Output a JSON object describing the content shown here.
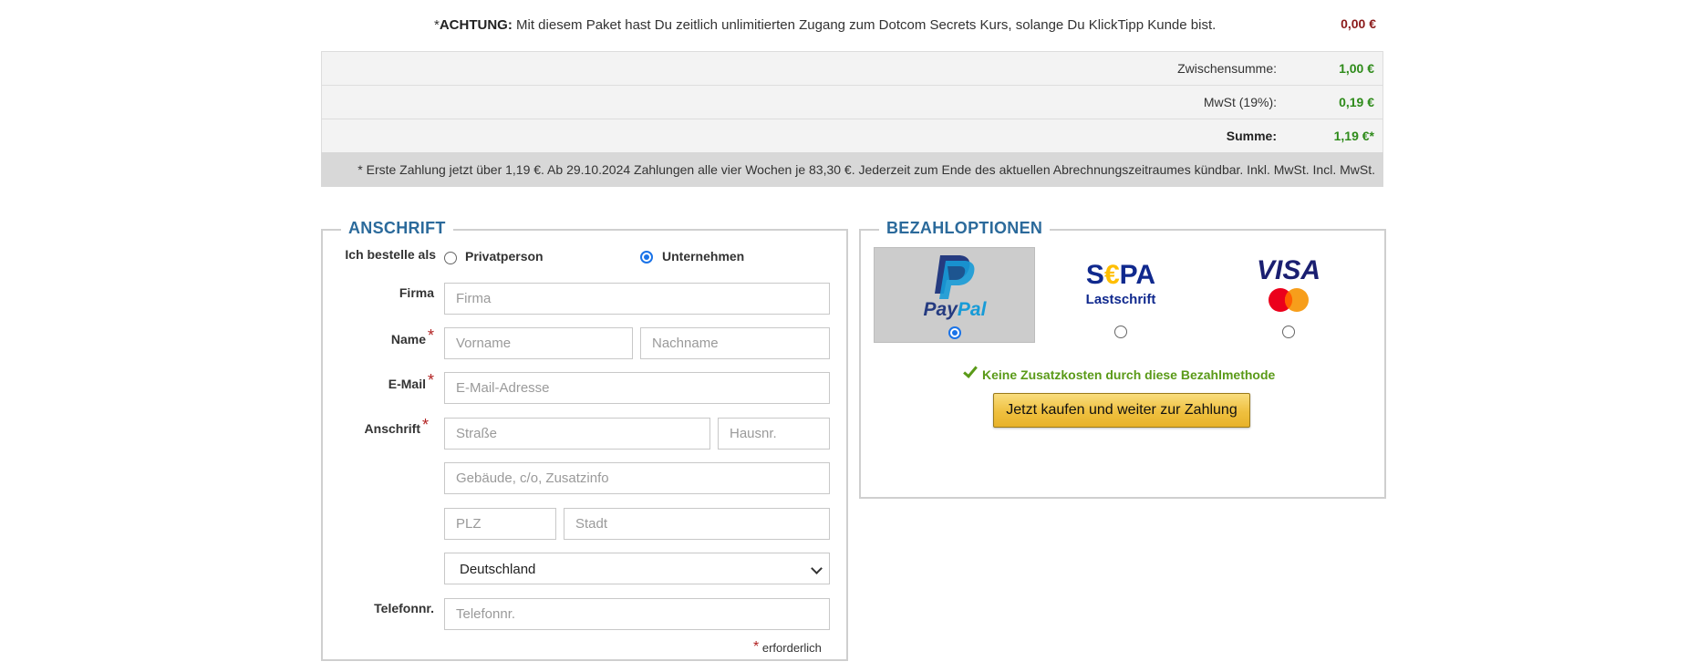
{
  "notice": {
    "prefix": "*",
    "bold": "ACHTUNG:",
    "text": " Mit diesem Paket hast Du zeitlich unlimitierten Zugang zum Dotcom Secrets Kurs, solange Du KlickTipp Kunde bist.",
    "price": "0,00 €"
  },
  "summary": {
    "rows": [
      {
        "label": "Zwischensumme:",
        "value": "1,00 €"
      },
      {
        "label": "MwSt (19%):",
        "value": "0,19 €"
      },
      {
        "label": "Summe:",
        "value": "1,19 €*"
      }
    ],
    "footnote": "* Erste Zahlung jetzt über 1,19 €. Ab 29.10.2024 Zahlungen alle vier Wochen je 83,30 €. Jederzeit zum Ende des aktuellen Abrechnungszeitraumes kündbar. Inkl. MwSt. Incl. MwSt."
  },
  "address": {
    "legend": "ANSCHRIFT",
    "order_as_label": "Ich bestelle als",
    "option_private": "Privatperson",
    "option_company": "Unternehmen",
    "selected": "Unternehmen",
    "company_label": "Firma",
    "company_placeholder": "Firma",
    "name_label": "Name",
    "firstname_placeholder": "Vorname",
    "lastname_placeholder": "Nachname",
    "email_label": "E-Mail",
    "email_placeholder": "E-Mail-Adresse",
    "address_label": "Anschrift",
    "street_placeholder": "Straße",
    "housenr_placeholder": "Hausnr.",
    "extra_placeholder": "Gebäude, c/o, Zusatzinfo",
    "zip_placeholder": "PLZ",
    "city_placeholder": "Stadt",
    "country_value": "Deutschland",
    "phone_label": "Telefonnr.",
    "phone_placeholder": "Telefonnr.",
    "required_star": "*",
    "required_note": "erforderlich"
  },
  "payment": {
    "legend": "BEZAHLOPTIONEN",
    "methods": [
      {
        "name": "PayPal",
        "selected": true
      },
      {
        "name": "SEPA Lastschrift",
        "logo_text": "S€PA",
        "sub": "Lastschrift",
        "selected": false
      },
      {
        "name": "Visa / Mastercard",
        "logo_text": "VISA",
        "selected": false
      }
    ],
    "no_fee_text": "Keine Zusatzkosten durch diese Bezahlmethode",
    "buy_button": "Jetzt kaufen und weiter zur Zahlung"
  },
  "colors": {
    "legend_blue": "#2b6a9b",
    "price_green": "#2e8b1a",
    "price_red": "#8b1a1a",
    "nofee_green": "#5a9a18",
    "button_gold": "#efc03f"
  }
}
